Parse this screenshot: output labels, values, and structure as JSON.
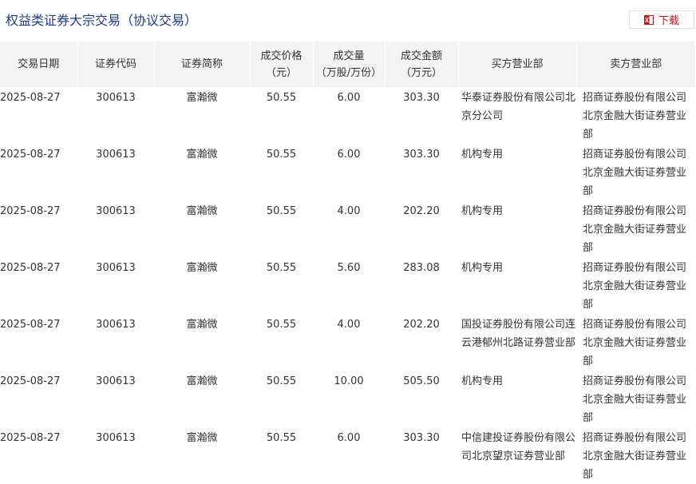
{
  "header": {
    "title": "权益类证券大宗交易（协议交易）",
    "download_label": "下载",
    "download_icon": "excel-icon"
  },
  "table": {
    "columns": [
      "交易日期",
      "证券代码",
      "证券简称",
      "成交价格（元）",
      "成交量（万股/万份）",
      "成交金额（万元）",
      "买方营业部",
      "卖方营业部"
    ],
    "rows": [
      {
        "date": "2025-08-27",
        "code": "300613",
        "name": "富瀚微",
        "price": "50.55",
        "volume": "6.00",
        "amount": "303.30",
        "buyer": "华泰证券股份有限公司北京分公司",
        "seller": "招商证券股份有限公司北京金融大街证券营业部"
      },
      {
        "date": "2025-08-27",
        "code": "300613",
        "name": "富瀚微",
        "price": "50.55",
        "volume": "6.00",
        "amount": "303.30",
        "buyer": "机构专用",
        "seller": "招商证券股份有限公司北京金融大街证券营业部"
      },
      {
        "date": "2025-08-27",
        "code": "300613",
        "name": "富瀚微",
        "price": "50.55",
        "volume": "4.00",
        "amount": "202.20",
        "buyer": "机构专用",
        "seller": "招商证券股份有限公司北京金融大街证券营业部"
      },
      {
        "date": "2025-08-27",
        "code": "300613",
        "name": "富瀚微",
        "price": "50.55",
        "volume": "5.60",
        "amount": "283.08",
        "buyer": "机构专用",
        "seller": "招商证券股份有限公司北京金融大街证券营业部"
      },
      {
        "date": "2025-08-27",
        "code": "300613",
        "name": "富瀚微",
        "price": "50.55",
        "volume": "4.00",
        "amount": "202.20",
        "buyer": "国投证券股份有限公司连云港郁州北路证券营业部",
        "seller": "招商证券股份有限公司北京金融大街证券营业部"
      },
      {
        "date": "2025-08-27",
        "code": "300613",
        "name": "富瀚微",
        "price": "50.55",
        "volume": "10.00",
        "amount": "505.50",
        "buyer": "机构专用",
        "seller": "招商证券股份有限公司北京金融大街证券营业部"
      },
      {
        "date": "2025-08-27",
        "code": "300613",
        "name": "富瀚微",
        "price": "50.55",
        "volume": "6.00",
        "amount": "303.30",
        "buyer": "中信建投证券股份有限公司北京望京证券营业部",
        "seller": "招商证券股份有限公司北京金融大街证券营业部"
      }
    ]
  },
  "colors": {
    "title": "#1f3c88",
    "accent": "#c8161d",
    "header_bg": "#f2f3f5"
  }
}
